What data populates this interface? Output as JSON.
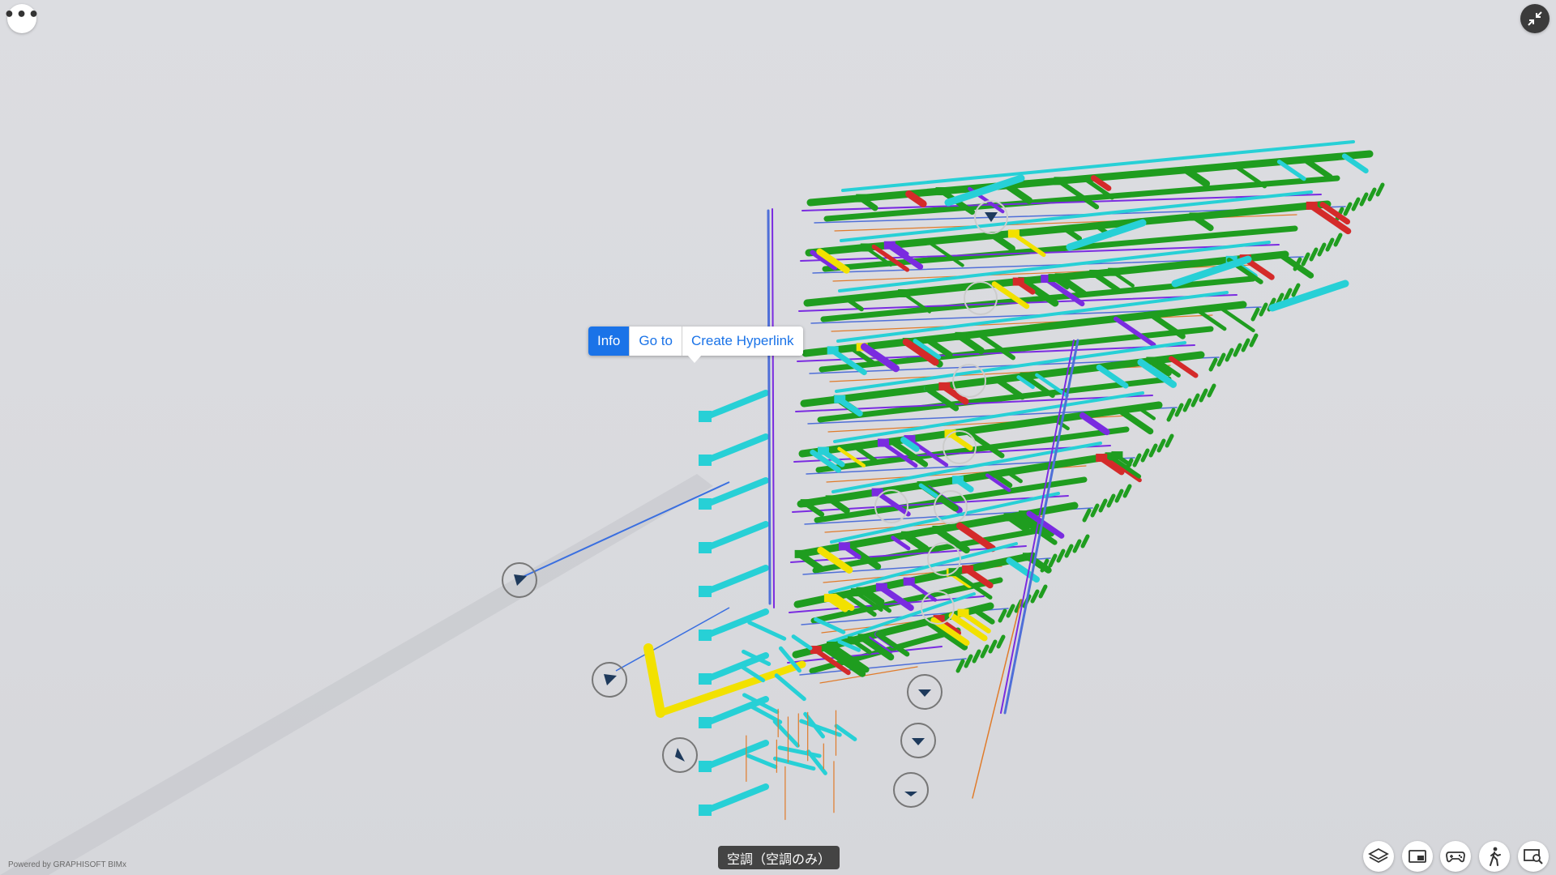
{
  "viewer": {
    "menu_glyph": "•••",
    "powered_by": "Powered by GRAPHISOFT BIMx",
    "layer_label": "空調（空調のみ）"
  },
  "context_menu": {
    "items": [
      "Info",
      "Go to",
      "Create Hyperlink"
    ],
    "active_item": "Info"
  },
  "toolbar": {
    "buttons": [
      "layers-icon",
      "viewport-icon",
      "gamepad-icon",
      "walk-icon",
      "search-view-icon"
    ]
  },
  "icons": {
    "menu": "more-horizontal-icon",
    "collapse": "collapse-arrows-icon"
  },
  "colors": {
    "accent": "#1a73e8",
    "pipe_green": "#1f9d1f",
    "pipe_cyan": "#27d0d6",
    "pipe_yellow": "#f2e100",
    "pipe_purple": "#7a2be0",
    "pipe_blue": "#4f6fd8",
    "pipe_red": "#d42a2a",
    "pipe_orange": "#e07b2a"
  }
}
